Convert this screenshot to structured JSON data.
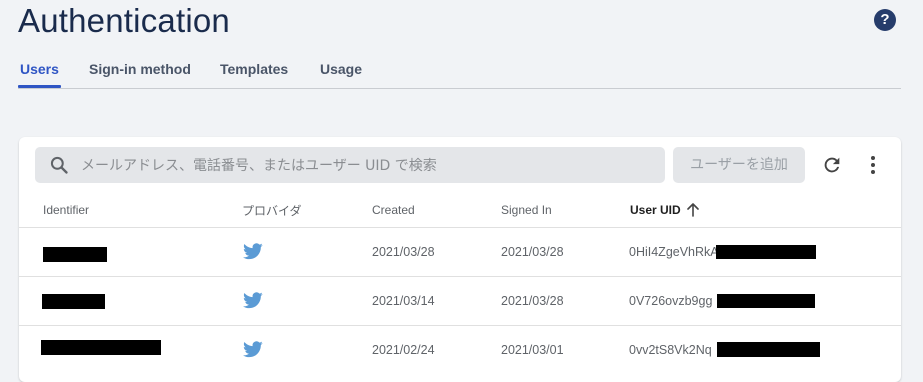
{
  "header": {
    "title": "Authentication",
    "help_icon": "help-icon"
  },
  "tabs": [
    {
      "label": "Users",
      "active": true
    },
    {
      "label": "Sign-in method",
      "active": false
    },
    {
      "label": "Templates",
      "active": false
    },
    {
      "label": "Usage",
      "active": false
    }
  ],
  "toolbar": {
    "search_placeholder": "メールアドレス、電話番号、またはユーザー UID で検索",
    "add_user_label": "ユーザーを追加",
    "refresh_icon": "refresh-icon",
    "more_icon": "more-vert-icon"
  },
  "table": {
    "columns": [
      "Identifier",
      "プロバイダ",
      "Created",
      "Signed In",
      "User UID"
    ],
    "sorted_column": "User UID",
    "sort_direction": "ascending",
    "rows": [
      {
        "identifier": "",
        "provider_icon": "twitter-icon",
        "created": "2021/03/28",
        "signed_in": "2021/03/28",
        "uid": "0HiI4ZgeVhRkA"
      },
      {
        "identifier": "",
        "provider_icon": "twitter-icon",
        "created": "2021/03/14",
        "signed_in": "2021/03/28",
        "uid": "0V726ovzb9gg"
      },
      {
        "identifier": "",
        "provider_icon": "twitter-icon",
        "created": "2021/02/24",
        "signed_in": "2021/03/01",
        "uid": "0vv2tS8Vk2Nq"
      }
    ]
  },
  "colors": {
    "accent": "#2f55c4",
    "title": "#1a2b4c",
    "twitter": "#5b9bd5",
    "background": "#f1f3f6"
  }
}
